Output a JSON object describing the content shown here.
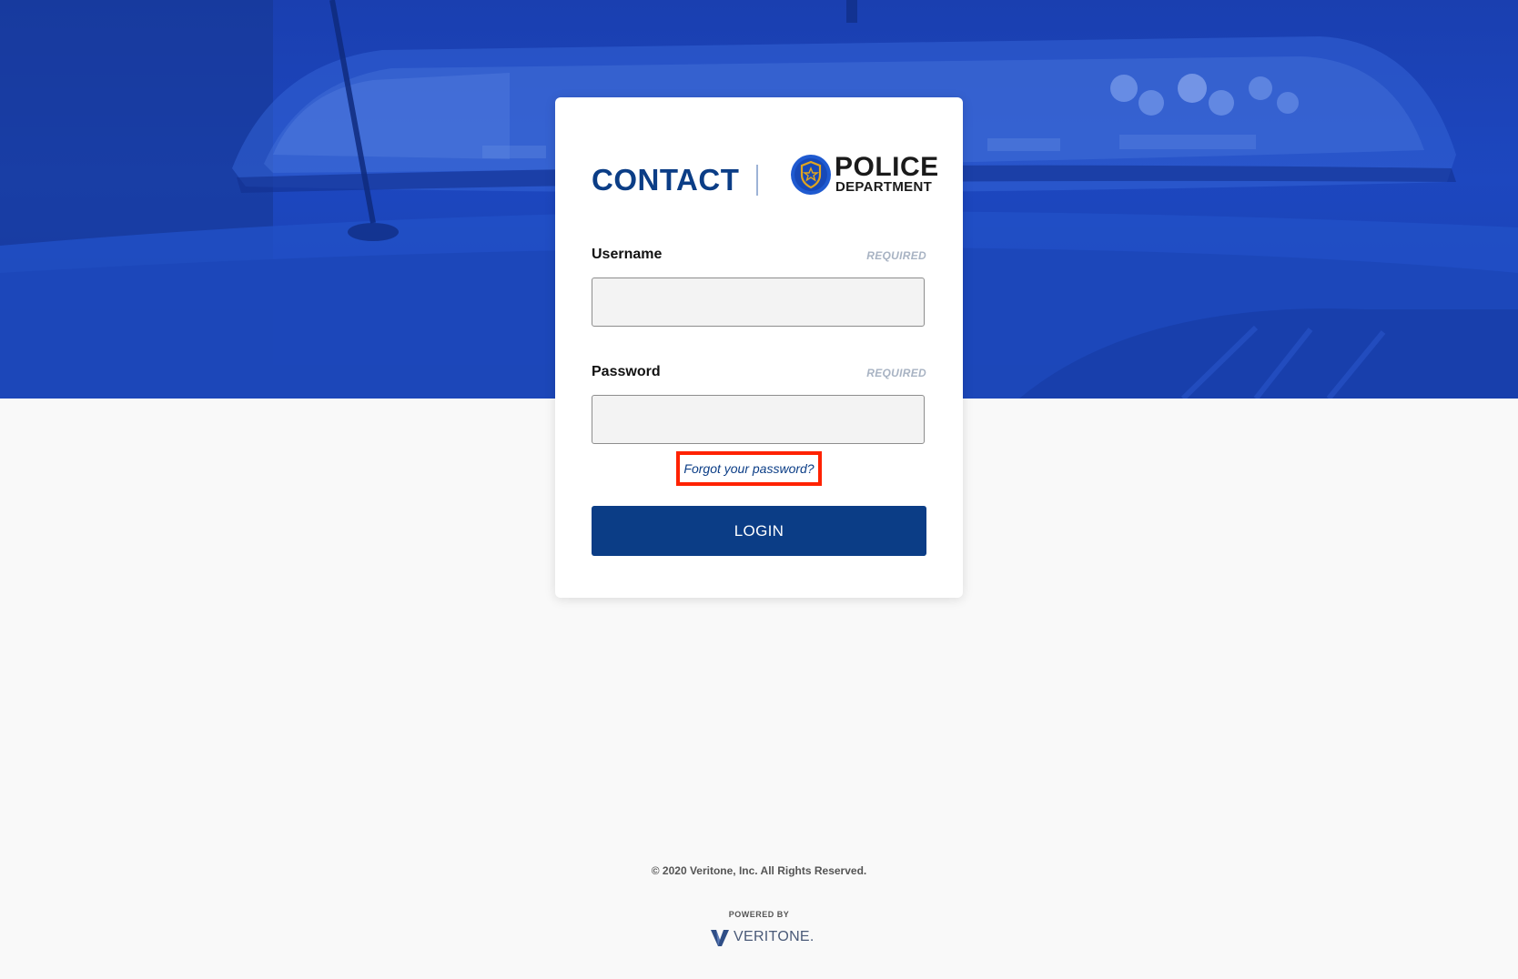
{
  "brand": {
    "contact_label": "CONTACT",
    "police_word": "POLICE",
    "police_sub": "DEPARTMENT",
    "badge_icon": "police-badge-icon"
  },
  "form": {
    "username": {
      "label": "Username",
      "required": "REQUIRED",
      "value": ""
    },
    "password": {
      "label": "Password",
      "required": "REQUIRED",
      "value": ""
    },
    "forgot_link": "Forgot your password?",
    "login_label": "LOGIN"
  },
  "footer": {
    "copyright": "© 2020 Veritone, Inc. All Rights Reserved.",
    "powered_by": "POWERED BY",
    "veritone_word": "VERITONE."
  },
  "colors": {
    "primary": "#0b3d86",
    "hero_blue": "#1d47bf",
    "highlight": "#ff2200",
    "input_bg": "#f3f3f3"
  }
}
